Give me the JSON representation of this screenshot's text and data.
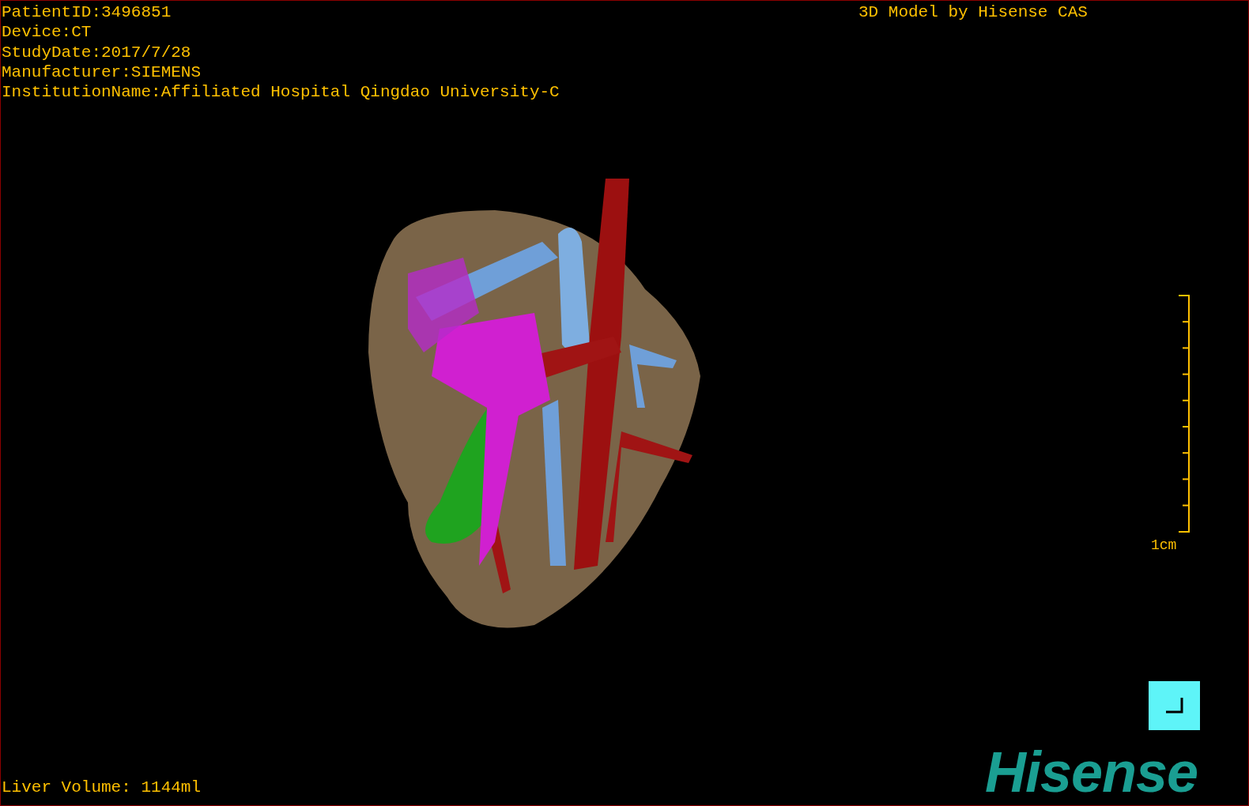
{
  "patient_info": [
    "PatientID:3496851",
    "Device:CT",
    "StudyDate:2017/7/28",
    "Manufacturer:SIEMENS",
    "InstitutionName:Affiliated Hospital Qingdao University-C"
  ],
  "title": "3D Model by Hisense CAS",
  "scale_bar": {
    "label": "1cm"
  },
  "liver_volume": "Liver Volume: 1144ml",
  "logo": "Hisense"
}
